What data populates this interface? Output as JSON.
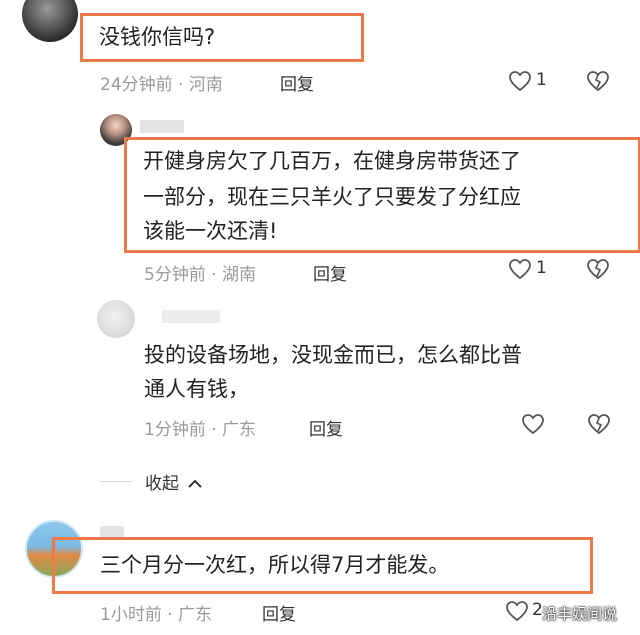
{
  "comments": [
    {
      "text": "没钱你信吗?",
      "time": "24分钟前",
      "location": "河南",
      "reply_label": "回复",
      "likes": "1"
    },
    {
      "text_lines": [
        "开健身房欠了几百万，在健身房带货还了",
        "一部分，现在三只羊火了只要发了分红应",
        "该能一次还清!"
      ],
      "time": "5分钟前",
      "location": "湖南",
      "reply_label": "回复",
      "likes": "1"
    },
    {
      "text_lines": [
        "投的设备场地，没现金而已，怎么都比普",
        "通人有钱，"
      ],
      "time": "1分钟前",
      "location": "广东",
      "reply_label": "回复",
      "likes": ""
    },
    {
      "text": "三个月分一次红，所以得7月才能发。",
      "time": "1小时前",
      "location": "广东",
      "reply_label": "回复",
      "likes": "2"
    }
  ],
  "collapse_label": "收起",
  "meta_separator": "·",
  "watermark": "沿丰娱间说",
  "colors": {
    "highlight_border": "#ee7a4a",
    "meta_text": "#9a9a9a",
    "body_text": "#222222"
  },
  "icons": [
    "heart-icon",
    "broken-heart-icon",
    "chevron-up-icon"
  ]
}
